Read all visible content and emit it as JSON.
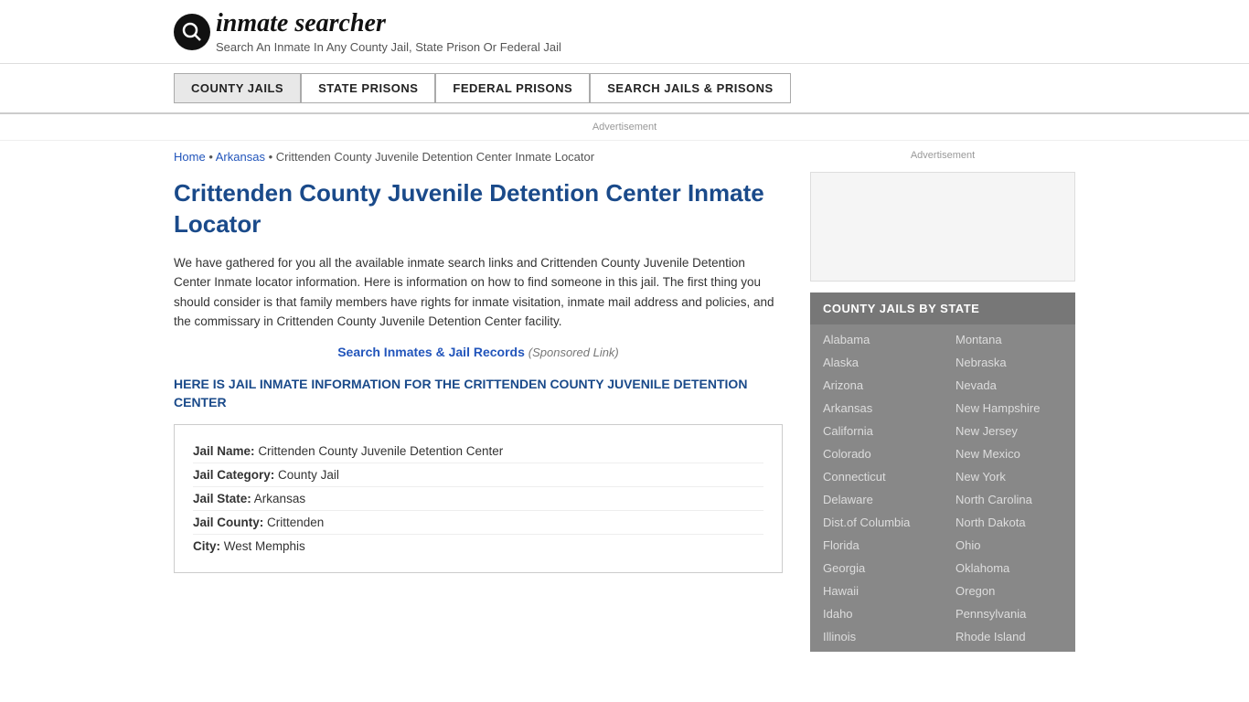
{
  "header": {
    "logo_icon": "Q",
    "logo_text": "inmate searcher",
    "tagline": "Search An Inmate In Any County Jail, State Prison Or Federal Jail"
  },
  "nav": {
    "items": [
      {
        "label": "COUNTY JAILS",
        "active": true
      },
      {
        "label": "STATE PRISONS",
        "active": false
      },
      {
        "label": "FEDERAL PRISONS",
        "active": false
      },
      {
        "label": "SEARCH JAILS & PRISONS",
        "active": false
      }
    ]
  },
  "ad_label": "Advertisement",
  "breadcrumb": {
    "home_label": "Home",
    "home_href": "#",
    "separator1": "▸",
    "state_label": "Arkansas",
    "state_href": "#",
    "separator2": "▸",
    "current": "Crittenden County Juvenile Detention Center Inmate Locator"
  },
  "page_title": "Crittenden County Juvenile Detention Center Inmate Locator",
  "description": "We have gathered for you all the available inmate search links and Crittenden County Juvenile Detention Center Inmate locator information. Here is information on how to find someone in this jail. The first thing you should consider is that family members have rights for inmate visitation, inmate mail address and policies, and the commissary in Crittenden County Juvenile Detention Center facility.",
  "sponsored": {
    "link_text": "Search Inmates & Jail Records",
    "suffix": "(Sponsored Link)"
  },
  "section_heading": "HERE IS JAIL INMATE INFORMATION FOR THE CRITTENDEN COUNTY JUVENILE DETENTION CENTER",
  "jail_info": {
    "name_label": "Jail Name:",
    "name_value": "Crittenden County Juvenile Detention Center",
    "category_label": "Jail Category:",
    "category_value": "County Jail",
    "state_label": "Jail State:",
    "state_value": "Arkansas",
    "county_label": "Jail County:",
    "county_value": "Crittenden",
    "city_label": "City:",
    "city_value": "West Memphis"
  },
  "sidebar": {
    "ad_label": "Advertisement",
    "section_title": "COUNTY JAILS BY STATE",
    "states_left": [
      "Alabama",
      "Alaska",
      "Arizona",
      "Arkansas",
      "California",
      "Colorado",
      "Connecticut",
      "Delaware",
      "Dist.of Columbia",
      "Florida",
      "Georgia",
      "Hawaii",
      "Idaho",
      "Illinois"
    ],
    "states_right": [
      "Montana",
      "Nebraska",
      "Nevada",
      "New Hampshire",
      "New Jersey",
      "New Mexico",
      "New York",
      "North Carolina",
      "North Dakota",
      "Ohio",
      "Oklahoma",
      "Oregon",
      "Pennsylvania",
      "Rhode Island"
    ]
  }
}
